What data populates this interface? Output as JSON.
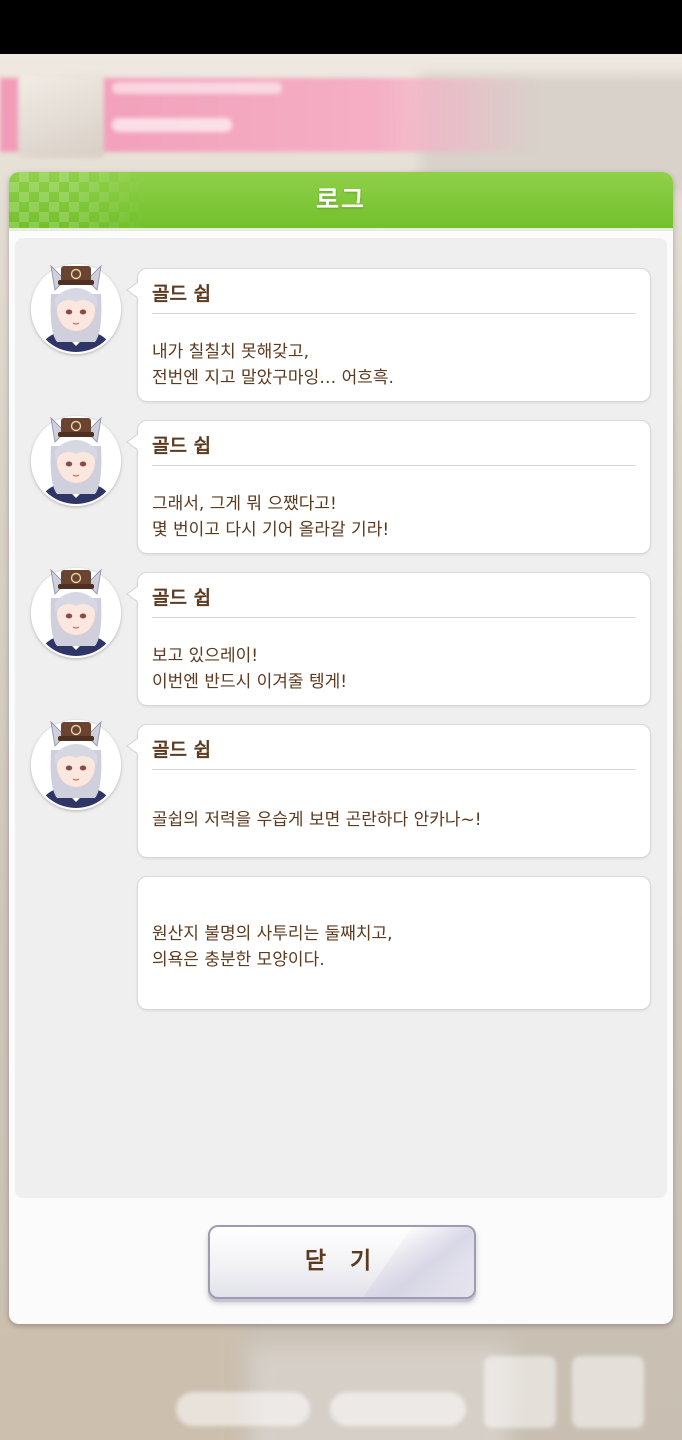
{
  "panel": {
    "title": "로그",
    "close_label": "닫 기"
  },
  "colors": {
    "header_green": "#7cc639",
    "text_brown": "#5b3a1f",
    "log_background": "#efefef"
  },
  "log_entries": [
    {
      "speaker": "골드 쉽",
      "has_avatar": true,
      "lines": [
        "내가 칠칠치 못해갖고,",
        "전번엔 지고 말았구마잉… 어흐흑."
      ]
    },
    {
      "speaker": "골드 쉽",
      "has_avatar": true,
      "lines": [
        "그래서, 그게 뭐 으쨌다고!",
        "몇 번이고 다시 기어 올라갈 기라!"
      ]
    },
    {
      "speaker": "골드 쉽",
      "has_avatar": true,
      "lines": [
        "보고 있으레이!",
        "이번엔 반드시 이겨줄 텡게!"
      ]
    },
    {
      "speaker": "골드 쉽",
      "has_avatar": true,
      "lines": [
        "골쉽의 저력을 우습게 보면 곤란하다 안카나~!"
      ]
    },
    {
      "speaker": "",
      "has_avatar": false,
      "lines": [
        "원산지 불명의 사투리는 둘째치고,",
        "의욕은 충분한 모양이다."
      ]
    }
  ]
}
